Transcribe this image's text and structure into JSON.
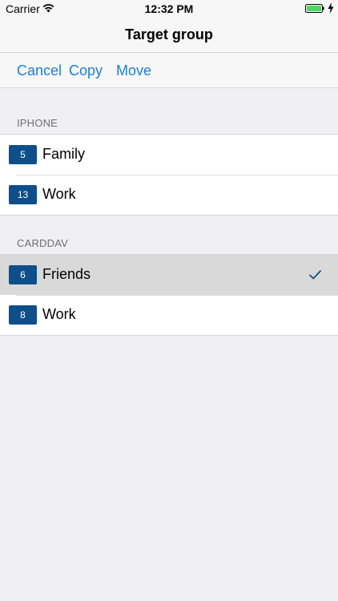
{
  "status_bar": {
    "carrier": "Carrier",
    "time": "12:32 PM",
    "icons": [
      "wifi-icon",
      "battery-icon",
      "charging-bolt-icon"
    ],
    "battery_color": "#4cd964"
  },
  "nav": {
    "title": "Target group"
  },
  "toolbar": {
    "cancel_label": "Cancel",
    "copy_label": "Copy",
    "move_label": "Move",
    "accent_color": "#1a7fd8"
  },
  "sections": [
    {
      "header": "IPHONE",
      "rows": [
        {
          "count": "5",
          "label": "Family",
          "selected": false
        },
        {
          "count": "13",
          "label": "Work",
          "selected": false
        }
      ]
    },
    {
      "header": "CARDDAV",
      "rows": [
        {
          "count": "6",
          "label": "Friends",
          "selected": true
        },
        {
          "count": "8",
          "label": "Work",
          "selected": false
        }
      ]
    }
  ],
  "badge_color": "#0e4f8b",
  "checkmark_icon": "checkmark-icon"
}
